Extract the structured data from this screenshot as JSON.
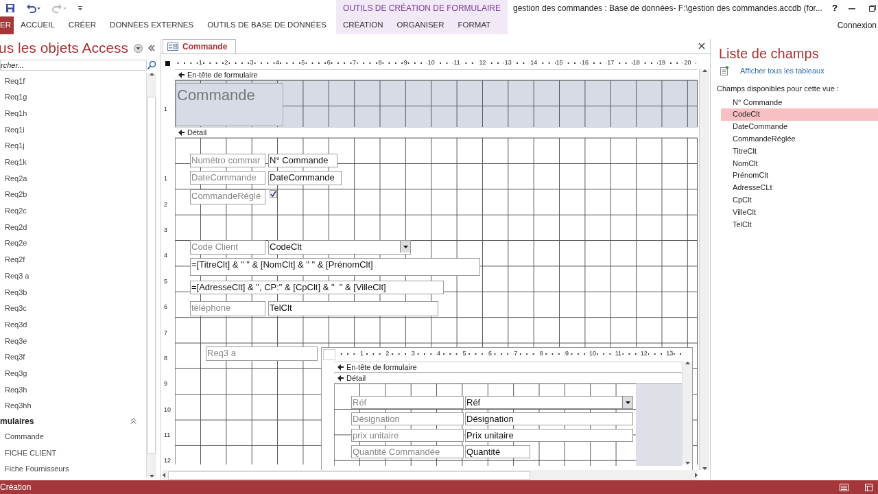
{
  "window": {
    "title": "gestion des commandes : Base de données- F:\\gestion des commandes.accdb (for...",
    "context_group": "OUTILS DE CRÉATION DE FORMULAIRE",
    "account": "Connexion",
    "help": "?"
  },
  "ribbon_tabs": [
    {
      "label": "ER",
      "kind": "file"
    },
    {
      "label": "ACCUEIL",
      "kind": "main"
    },
    {
      "label": "CRÉER",
      "kind": "main"
    },
    {
      "label": "DONNÉES EXTERNES",
      "kind": "main"
    },
    {
      "label": "OUTILS DE BASE DE DONNÉES",
      "kind": "main"
    },
    {
      "label": "CRÉATION",
      "kind": "contextual"
    },
    {
      "label": "ORGANISER",
      "kind": "contextual"
    },
    {
      "label": "FORMAT",
      "kind": "contextual"
    }
  ],
  "nav_pane": {
    "title": "us les objets Access",
    "search": {
      "placeholder": "rcher..."
    },
    "items": [
      "Req1f",
      "Req1g",
      "Req1h",
      "Req1i",
      "Req1j",
      "Req1k",
      "Req2a",
      "Req2b",
      "Req2c",
      "Req2d",
      "Req2e",
      "Req2f",
      "Req3 a",
      "Req3b",
      "Req3c",
      "Req3d",
      "Req3e",
      "Req3f",
      "Req3g",
      "Req3h",
      "Req3hh"
    ],
    "group": {
      "title": "mulaires",
      "expanded": true,
      "items": [
        "Commande",
        "FICHE CLIENT",
        "Fiche Fournisseurs"
      ]
    }
  },
  "document_tab": {
    "title": "Commande"
  },
  "ruler": [
    "1",
    "2",
    "3",
    "4",
    "5",
    "6",
    "7",
    "8",
    "9",
    "10",
    "11",
    "12",
    "13",
    "14",
    "15",
    "16",
    "17",
    "18",
    "19",
    "20"
  ],
  "vertical_ruler": {
    "header": [
      "1"
    ],
    "detail": [
      "1",
      "2",
      "3",
      "4",
      "5",
      "6",
      "7",
      "8",
      "9",
      "10",
      "11",
      "12"
    ]
  },
  "form": {
    "header_section": "En-tête de formulaire",
    "detail_section": "Détail",
    "header_controls": [
      {
        "kind": "title",
        "text": "Commande"
      }
    ],
    "detail_controls": [
      {
        "kind": "label",
        "text": "Numétro commar"
      },
      {
        "kind": "textbox",
        "text": "N° Commande"
      },
      {
        "kind": "label",
        "text": "DateCommande"
      },
      {
        "kind": "textbox",
        "text": "DateCommande"
      },
      {
        "kind": "label",
        "text": "CommandeRéglé"
      },
      {
        "kind": "checkbox",
        "checked": true
      },
      {
        "kind": "label",
        "text": "Code Client"
      },
      {
        "kind": "combobox",
        "text": "CodeClt"
      },
      {
        "kind": "textbox",
        "text": "=[TitreClt] & \" \" & [NomClt] & \" \" & [PrénomClt]"
      },
      {
        "kind": "textbox",
        "text": "=[AdresseClt] & \", CP:\" & [CpClt] & \"  \" & [VilleClt]"
      },
      {
        "kind": "label",
        "text": "téléphone"
      },
      {
        "kind": "textbox",
        "text": "TelClt"
      },
      {
        "kind": "label",
        "text": "Req3 a"
      }
    ]
  },
  "subform": {
    "ruler": [
      "1",
      "2",
      "3",
      "4",
      "5",
      "6",
      "7",
      "8",
      "9",
      "10",
      "11",
      "12",
      "13"
    ],
    "header_section": "En-tête de formulaire",
    "detail_section": "Détail",
    "controls": [
      {
        "kind": "label",
        "text": "Réf"
      },
      {
        "kind": "combobox",
        "text": "Réf"
      },
      {
        "kind": "label",
        "text": "Désignation"
      },
      {
        "kind": "textbox",
        "text": "Désignation"
      },
      {
        "kind": "label",
        "text": "prix unitaire"
      },
      {
        "kind": "textbox",
        "text": "Prix unitaire"
      },
      {
        "kind": "label",
        "text": "Quantité Commandée"
      },
      {
        "kind": "textbox",
        "text": "Quantité"
      }
    ]
  },
  "field_list": {
    "title": "Liste de champs",
    "show_all_link": "Afficher tous les tableaux",
    "caption": "Champs disponibles pour cette vue :",
    "fields": [
      {
        "label": "N° Commande",
        "selected": false
      },
      {
        "label": "CodeClt",
        "selected": true
      },
      {
        "label": "DateCommande",
        "selected": false
      },
      {
        "label": "CommandeRéglée",
        "selected": false
      },
      {
        "label": "TitreClt",
        "selected": false
      },
      {
        "label": "NomClt",
        "selected": false
      },
      {
        "label": "PrénomClt",
        "selected": false
      },
      {
        "label": "AdresseCLt",
        "selected": false
      },
      {
        "label": "CpClt",
        "selected": false
      },
      {
        "label": "VilleClt",
        "selected": false
      },
      {
        "label": "TelClt",
        "selected": false
      }
    ]
  },
  "status_bar": {
    "text": "Création"
  }
}
